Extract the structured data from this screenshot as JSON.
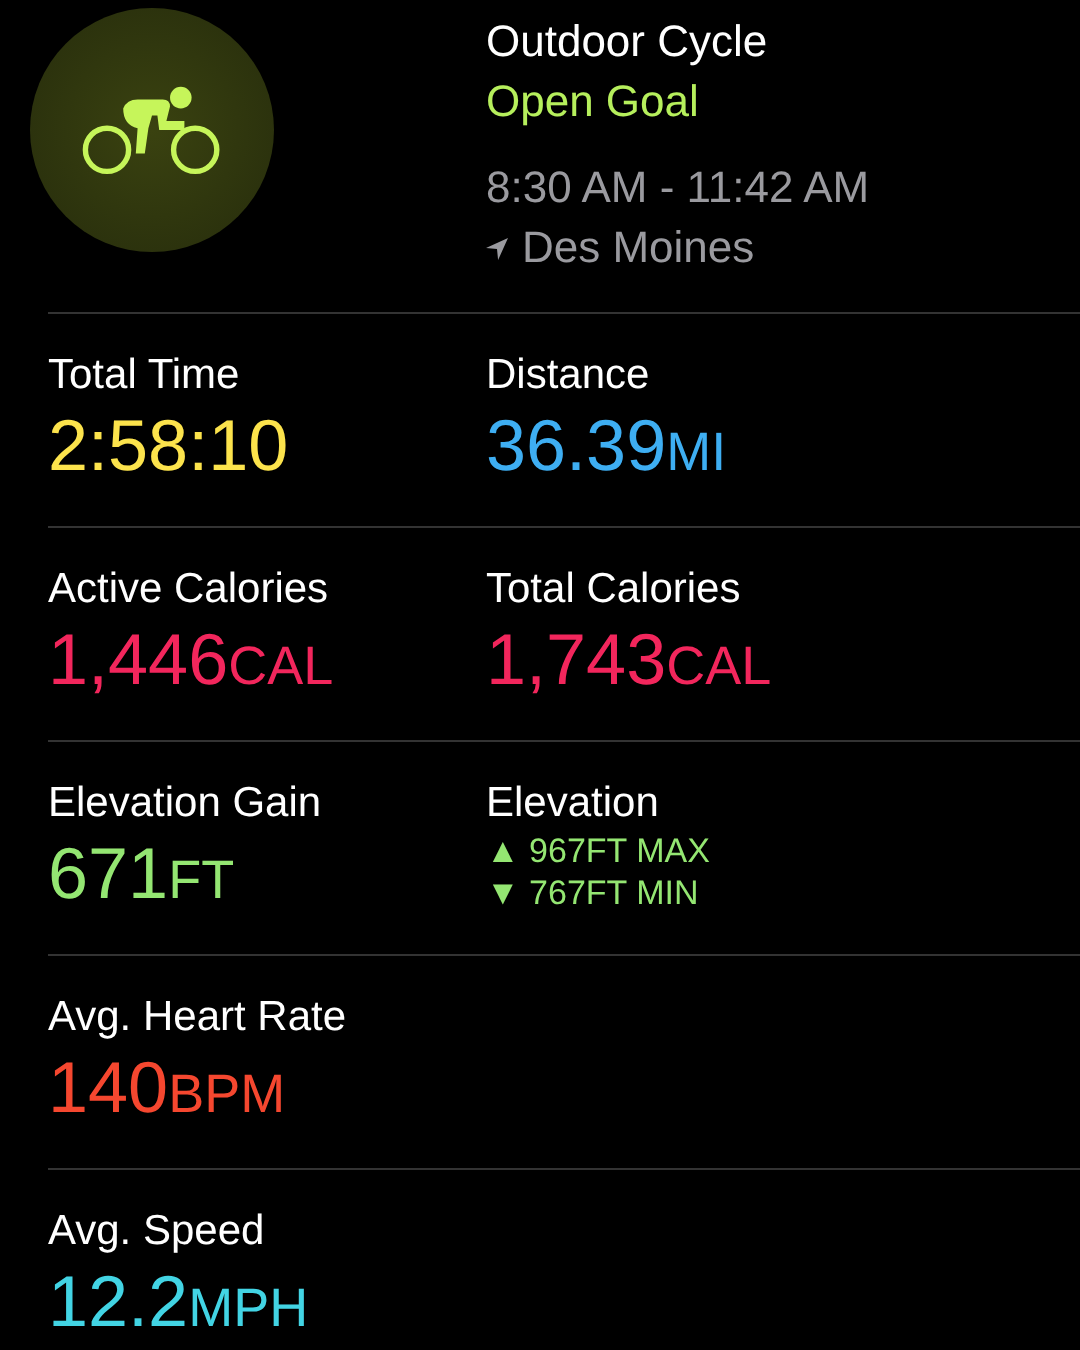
{
  "workout": {
    "title": "Outdoor Cycle",
    "goal": "Open Goal",
    "time_range": "8:30 AM - 11:42 AM",
    "location": "Des Moines"
  },
  "rows": [
    [
      {
        "kind": "value",
        "label": "Total Time",
        "value": "2:58:10",
        "color": "#fce34c"
      },
      {
        "kind": "value",
        "label": "Distance",
        "value": "36.39",
        "unit": "MI",
        "color": "#3eaef2"
      }
    ],
    [
      {
        "kind": "value",
        "label": "Active Calories",
        "value": "1,446",
        "unit": "CAL",
        "color": "#f2265c"
      },
      {
        "kind": "value",
        "label": "Total Calories",
        "value": "1,743",
        "unit": "CAL",
        "color": "#f2265c"
      }
    ],
    [
      {
        "kind": "value",
        "label": "Elevation Gain",
        "value": "671",
        "unit": "FT",
        "color": "#94e672"
      },
      {
        "kind": "range",
        "label": "Elevation",
        "lines": [
          {
            "arrow": "▲",
            "text": "967FT MAX"
          },
          {
            "arrow": "▼",
            "text": "767FT MIN"
          }
        ],
        "color": "#94e672"
      }
    ],
    [
      {
        "kind": "value",
        "label": "Avg. Heart Rate",
        "value": "140",
        "unit": "BPM",
        "color": "#f5472f"
      }
    ],
    [
      {
        "kind": "value",
        "label": "Avg. Speed",
        "value": "12.2",
        "unit": "MPH",
        "color": "#42d4e4"
      }
    ]
  ]
}
